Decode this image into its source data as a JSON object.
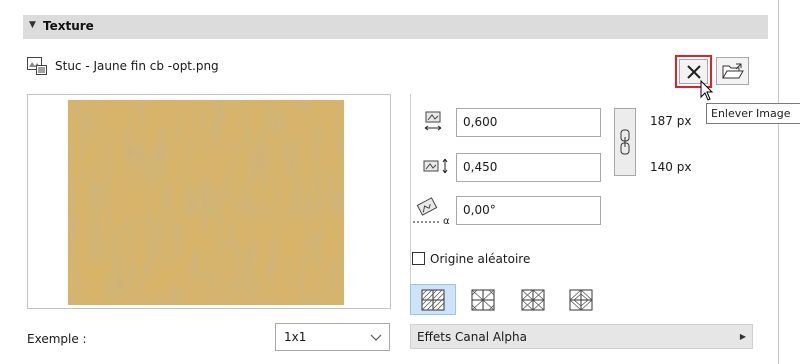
{
  "section": {
    "title": "Texture"
  },
  "file": {
    "name": "Stuc - Jaune fin cb -opt.png"
  },
  "buttons": {
    "remove_icon": "close-icon",
    "open_icon": "folder-open-icon"
  },
  "tooltip": {
    "text": "Enlever Image"
  },
  "size": {
    "width_value": "0,600",
    "height_value": "0,450",
    "width_px": "187 px",
    "height_px": "140 px",
    "angle_value": "0,00°"
  },
  "random_origin": {
    "label": "Origine aléatoire",
    "checked": false
  },
  "patterns": [
    {
      "name": "tile-pattern-1",
      "selected": true
    },
    {
      "name": "tile-pattern-2",
      "selected": false
    },
    {
      "name": "tile-pattern-3",
      "selected": false
    },
    {
      "name": "tile-pattern-4",
      "selected": false
    }
  ],
  "example": {
    "label": "Exemple :",
    "selected": "1x1"
  },
  "alpha": {
    "label": "Effets Canal Alpha"
  },
  "colors": {
    "accent_red": "#e0202a",
    "selection_blue": "#cfe3f8",
    "texture": "#d8b46a"
  }
}
